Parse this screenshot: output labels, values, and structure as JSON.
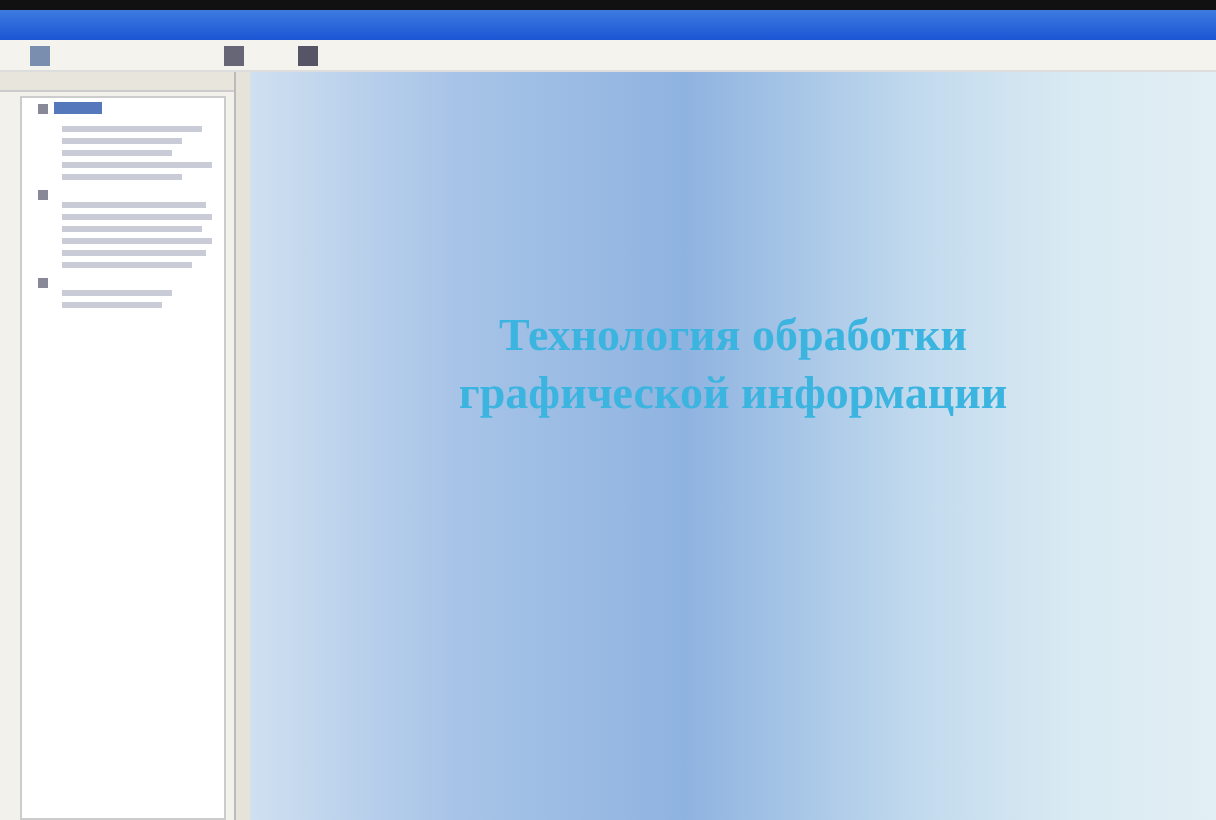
{
  "slide": {
    "title": "Технология обработки графической информации"
  }
}
